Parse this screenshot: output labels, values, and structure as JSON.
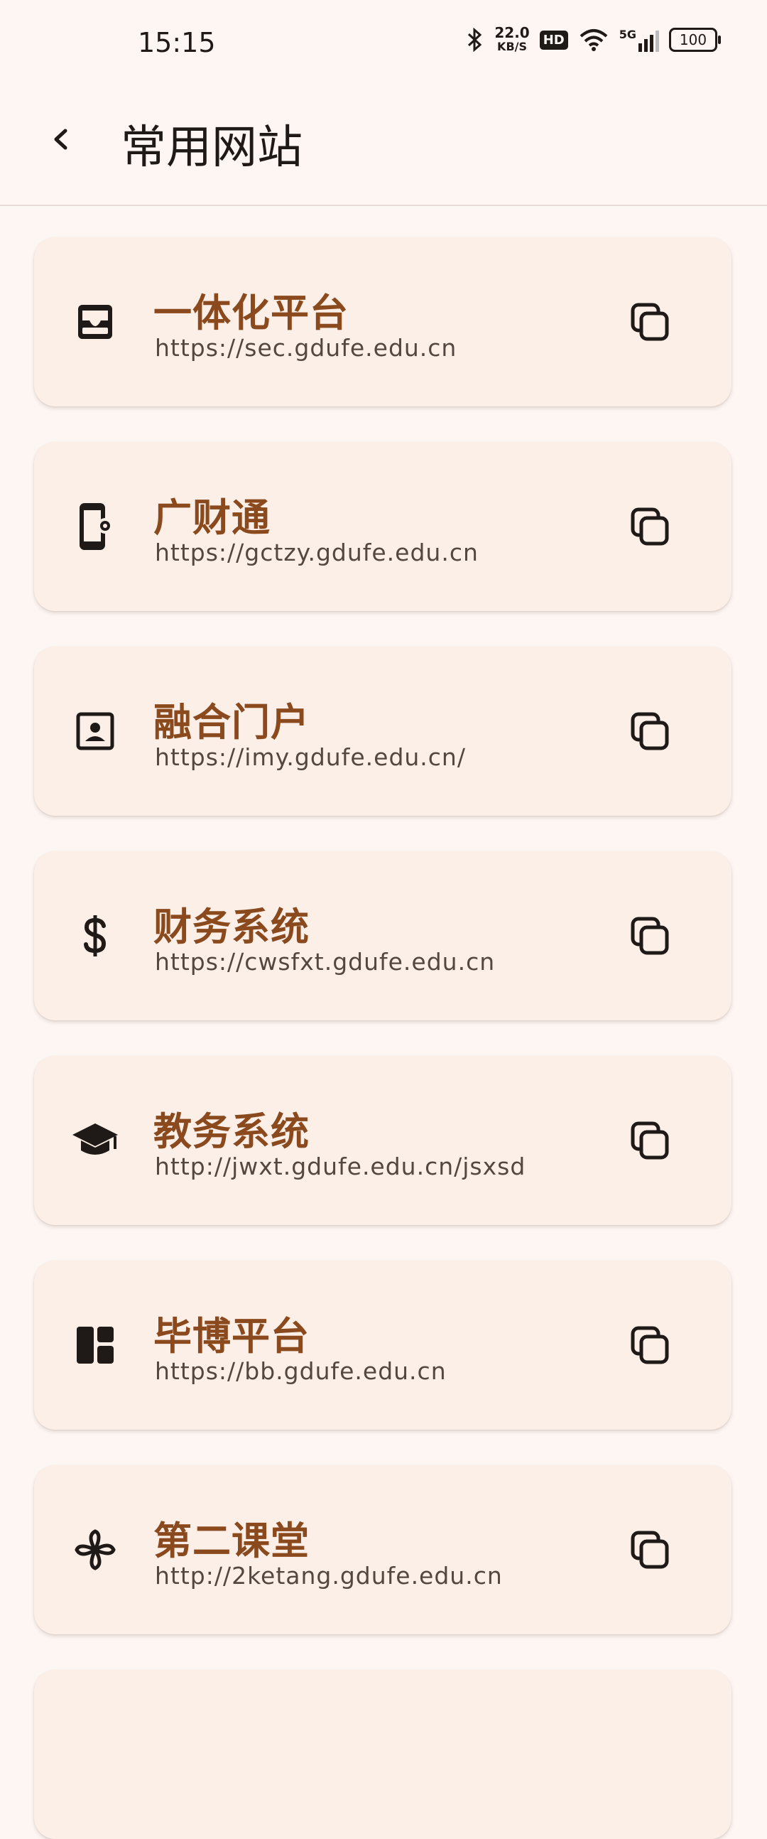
{
  "status_bar": {
    "time": "15:15",
    "net_speed": "22.0",
    "net_unit": "KB/S",
    "hd": "HD",
    "signal": "5G",
    "battery": "100"
  },
  "header": {
    "title": "常用网站",
    "back_icon": "chevron-left-icon"
  },
  "sites": [
    {
      "title": "一体化平台",
      "url": "https://sec.gdufe.edu.cn",
      "icon": "inbox-icon"
    },
    {
      "title": "广财通",
      "url": "https://gctzy.gdufe.edu.cn",
      "icon": "phone-settings-icon"
    },
    {
      "title": "融合门户",
      "url": "https://imy.gdufe.edu.cn/",
      "icon": "contact-card-icon"
    },
    {
      "title": "财务系统",
      "url": "https://cwsfxt.gdufe.edu.cn",
      "icon": "dollar-icon"
    },
    {
      "title": "教务系统",
      "url": "http://jwxt.gdufe.edu.cn/jsxsd",
      "icon": "graduation-cap-icon"
    },
    {
      "title": "毕博平台",
      "url": "https://bb.gdufe.edu.cn",
      "icon": "dashboard-icon"
    },
    {
      "title": "第二课堂",
      "url": "http://2ketang.gdufe.edu.cn",
      "icon": "pinwheel-icon"
    }
  ],
  "colors": {
    "background": "#fdf6f3",
    "card": "#fcefe8",
    "title": "#8b4a1e",
    "url": "#544741",
    "icon": "#1f1a17"
  }
}
